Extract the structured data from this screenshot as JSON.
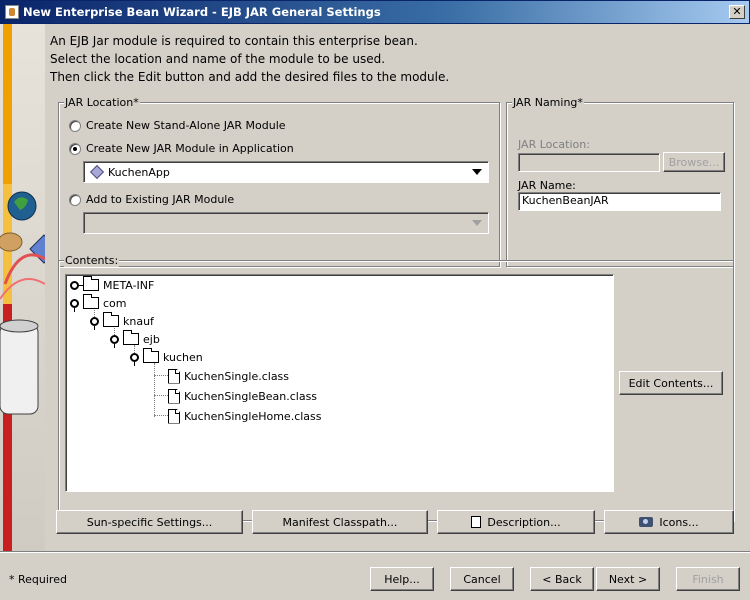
{
  "window": {
    "title": "New Enterprise Bean Wizard - EJB JAR General Settings",
    "close_label": "✕"
  },
  "intro": {
    "line1": "An EJB Jar module is required to contain this enterprise bean.",
    "line2": "Select the location and name of the module to be used.",
    "line3": "Then click the Edit button and add the desired files to the module."
  },
  "jar_location": {
    "legend": "JAR Location*",
    "option_standalone": "Create New Stand-Alone JAR Module",
    "option_in_app": "Create New JAR Module in Application",
    "app_combo_value": "KuchenApp",
    "option_existing": "Add to Existing JAR Module",
    "existing_combo_value": "",
    "selected": "option_in_app"
  },
  "jar_naming": {
    "legend": "JAR Naming*",
    "location_label": "JAR Location:",
    "location_value": "",
    "browse_label": "Browse...",
    "name_label": "JAR Name:",
    "name_value": "KuchenBeanJAR"
  },
  "contents": {
    "legend": "Contents:",
    "tree": [
      {
        "label": "META-INF",
        "type": "folder",
        "expanded": false
      },
      {
        "label": "com",
        "type": "folder",
        "expanded": true
      },
      {
        "label": "knauf",
        "type": "folder",
        "expanded": true
      },
      {
        "label": "ejb",
        "type": "folder",
        "expanded": true
      },
      {
        "label": "kuchen",
        "type": "folder",
        "expanded": true
      },
      {
        "label": "KuchenSingle.class",
        "type": "file"
      },
      {
        "label": "KuchenSingleBean.class",
        "type": "file"
      },
      {
        "label": "KuchenSingleHome.class",
        "type": "file"
      }
    ],
    "edit_button": "Edit Contents..."
  },
  "actions": {
    "sun_settings": "Sun-specific Settings...",
    "manifest": "Manifest Classpath...",
    "description": "Description...",
    "icons": "Icons..."
  },
  "footer": {
    "required_note": "* Required",
    "help": "Help...",
    "cancel": "Cancel",
    "back": "< Back",
    "next": "Next >",
    "finish": "Finish"
  },
  "icons": {
    "app": "java-cup-icon",
    "close": "close-icon",
    "app_combo": "diamond-icon",
    "description": "page-icon",
    "icons_button": "camera-icon"
  },
  "colors": {
    "titlebar_start": "#0a246a",
    "titlebar_end": "#a6caf0",
    "dialog_bg": "#d4d0c8"
  }
}
